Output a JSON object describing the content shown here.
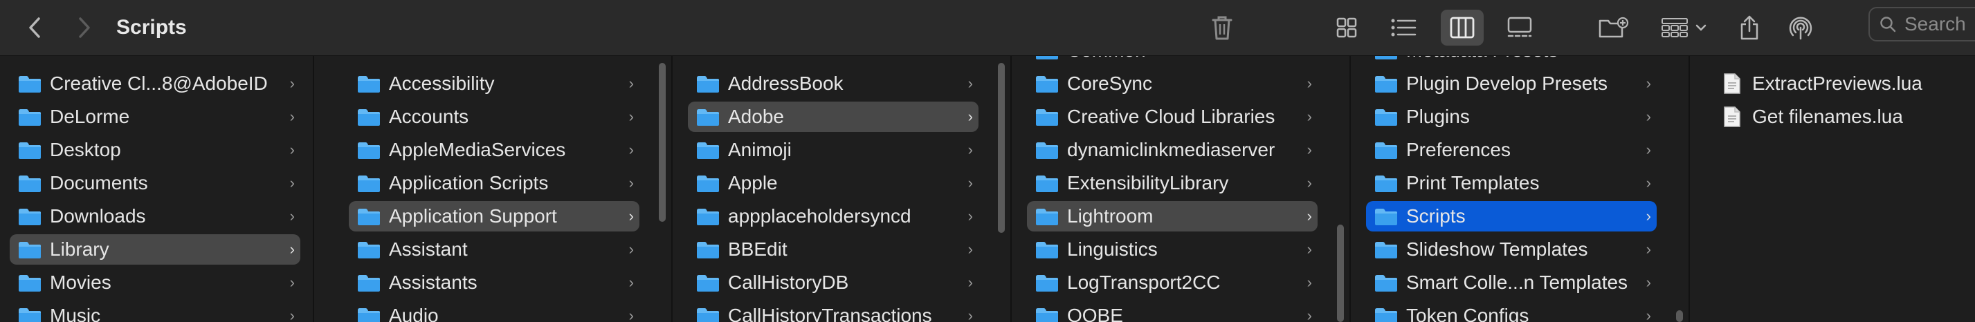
{
  "window": {
    "title": "Scripts"
  },
  "toolbar": {
    "search_placeholder": "Search"
  },
  "columns": [
    {
      "items": [
        {
          "label": "Creative Cl...8@AdobeID",
          "kind": "folder"
        },
        {
          "label": "DeLorme",
          "kind": "folder"
        },
        {
          "label": "Desktop",
          "kind": "folder"
        },
        {
          "label": "Documents",
          "kind": "folder"
        },
        {
          "label": "Downloads",
          "kind": "folder"
        },
        {
          "label": "Library",
          "kind": "folder",
          "selected": "gray"
        },
        {
          "label": "Movies",
          "kind": "folder"
        },
        {
          "label": "Music",
          "kind": "folder"
        }
      ]
    },
    {
      "items": [
        {
          "label": "Accessibility",
          "kind": "folder"
        },
        {
          "label": "Accounts",
          "kind": "folder"
        },
        {
          "label": "AppleMediaServices",
          "kind": "folder"
        },
        {
          "label": "Application Scripts",
          "kind": "folder"
        },
        {
          "label": "Application Support",
          "kind": "folder",
          "selected": "gray"
        },
        {
          "label": "Assistant",
          "kind": "folder"
        },
        {
          "label": "Assistants",
          "kind": "folder"
        },
        {
          "label": "Audio",
          "kind": "folder"
        }
      ]
    },
    {
      "items": [
        {
          "label": "AddressBook",
          "kind": "folder"
        },
        {
          "label": "Adobe",
          "kind": "folder",
          "selected": "gray"
        },
        {
          "label": "Animoji",
          "kind": "folder"
        },
        {
          "label": "Apple",
          "kind": "folder"
        },
        {
          "label": "appplaceholdersyncd",
          "kind": "folder"
        },
        {
          "label": "BBEdit",
          "kind": "folder"
        },
        {
          "label": "CallHistoryDB",
          "kind": "folder"
        },
        {
          "label": "CallHistoryTransactions",
          "kind": "folder"
        }
      ]
    },
    {
      "items": [
        {
          "label": "Common",
          "kind": "folder"
        },
        {
          "label": "CoreSync",
          "kind": "folder"
        },
        {
          "label": "Creative Cloud Libraries",
          "kind": "folder"
        },
        {
          "label": "dynamiclinkmediaserver",
          "kind": "folder"
        },
        {
          "label": "ExtensibilityLibrary",
          "kind": "folder"
        },
        {
          "label": "Lightroom",
          "kind": "folder",
          "selected": "gray"
        },
        {
          "label": "Linguistics",
          "kind": "folder"
        },
        {
          "label": "LogTransport2CC",
          "kind": "folder"
        },
        {
          "label": "OOBE",
          "kind": "folder"
        }
      ]
    },
    {
      "items": [
        {
          "label": "Metadata Presets",
          "kind": "folder"
        },
        {
          "label": "Plugin Develop Presets",
          "kind": "folder"
        },
        {
          "label": "Plugins",
          "kind": "folder"
        },
        {
          "label": "Preferences",
          "kind": "folder"
        },
        {
          "label": "Print Templates",
          "kind": "folder"
        },
        {
          "label": "Scripts",
          "kind": "folder",
          "selected": "blue"
        },
        {
          "label": "Slideshow Templates",
          "kind": "folder"
        },
        {
          "label": "Smart Colle...n Templates",
          "kind": "folder"
        },
        {
          "label": "Token Configs",
          "kind": "folder"
        }
      ]
    },
    {
      "items": [
        {
          "label": "ExtractPreviews.lua",
          "kind": "file"
        },
        {
          "label": "Get filenames.lua",
          "kind": "file"
        }
      ]
    }
  ],
  "colors": {
    "accent": "#0a5bd7",
    "folder": "#3aa0ee",
    "folder_tab": "#62b8f5"
  }
}
